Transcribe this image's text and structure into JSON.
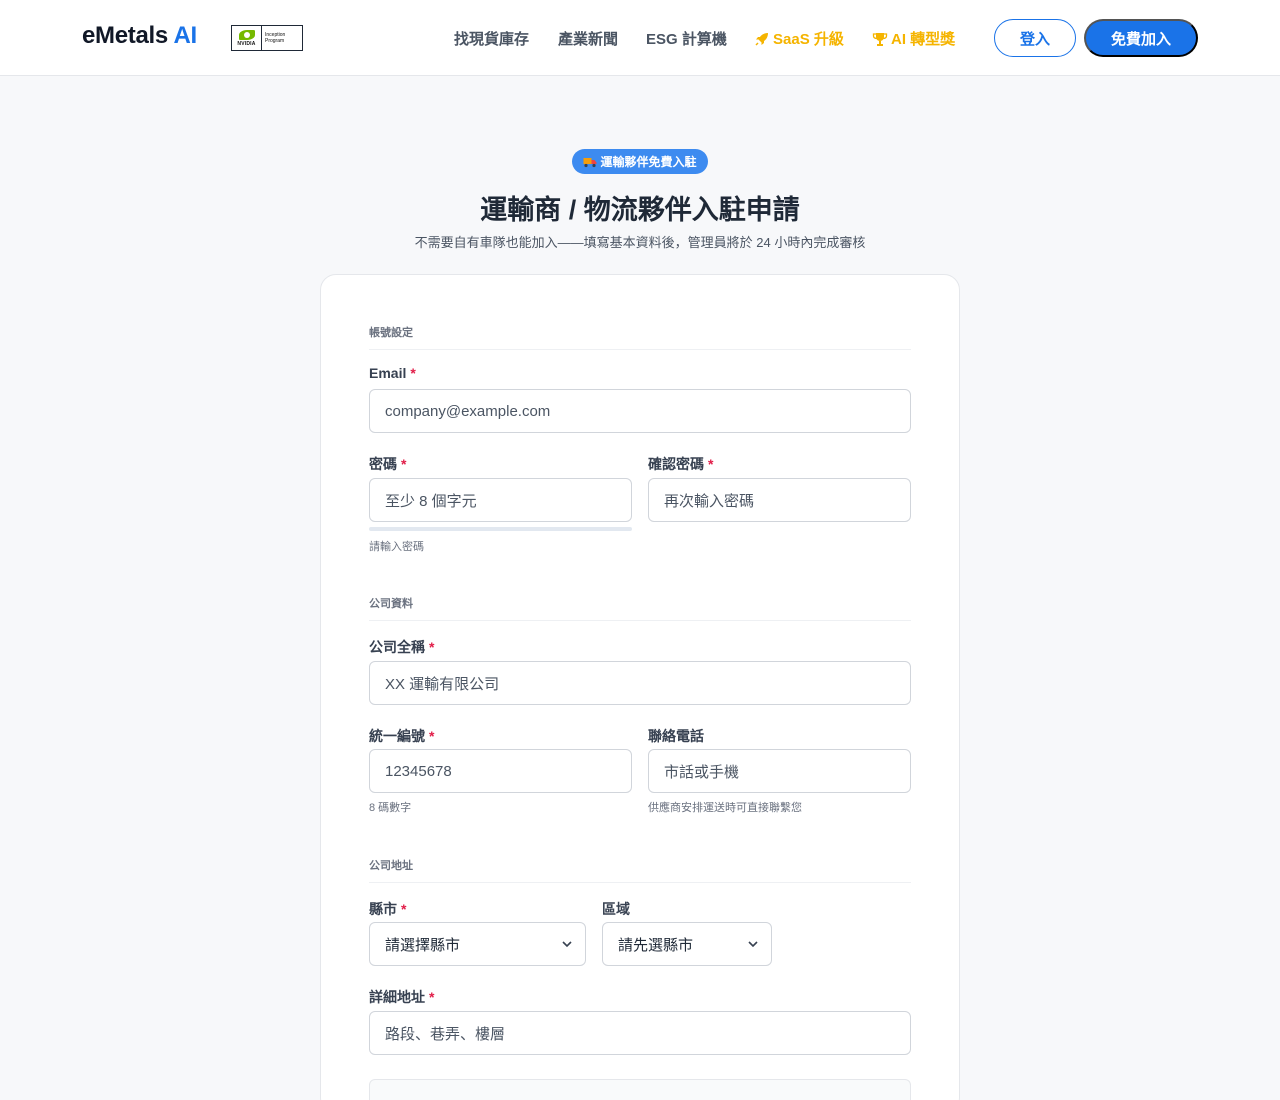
{
  "header": {
    "brand_main": "eMetals",
    "brand_ai": "AI",
    "badge_logo": "NVIDIA",
    "badge_text_1": "Inception",
    "badge_text_2": "Program",
    "nav": [
      {
        "label": "找現貨庫存"
      },
      {
        "label": "產業新聞"
      },
      {
        "label": "ESG 計算機"
      },
      {
        "label": "SaaS 升級",
        "icon": "rocket-icon"
      },
      {
        "label": "AI 轉型獎",
        "icon": "trophy-icon"
      }
    ],
    "login_label": "登入",
    "join_label": "免費加入",
    "accent_color": "#1a73e8",
    "gold_color": "#f5b400"
  },
  "hero": {
    "pill_icon": "truck-icon",
    "pill_label": "運輸夥伴免費入駐",
    "title": "運輸商 / 物流夥伴入駐申請",
    "subtitle": "不需要自有車隊也能加入——填寫基本資料後，管理員將於 24 小時內完成審核"
  },
  "form": {
    "account": {
      "section_title": "帳號設定",
      "email": {
        "label": "Email",
        "placeholder": "company@example.com"
      },
      "password": {
        "label": "密碼",
        "placeholder": "至少 8 個字元",
        "hint": "請輸入密碼"
      },
      "confirm": {
        "label": "確認密碼",
        "placeholder": "再次輸入密碼"
      }
    },
    "company": {
      "section_title": "公司資料",
      "name": {
        "label": "公司全稱",
        "placeholder": "XX 運輸有限公司"
      },
      "tax_id": {
        "label": "統一編號",
        "placeholder": "12345678",
        "hint": "8 碼數字"
      },
      "phone": {
        "label": "聯絡電話",
        "placeholder": "市話或手機",
        "hint": "供應商安排運送時可直接聯繫您"
      }
    },
    "address": {
      "section_title": "公司地址",
      "city": {
        "label": "縣市",
        "selected": "請選擇縣市"
      },
      "district": {
        "label": "區域",
        "selected": "請先選縣市"
      },
      "detail": {
        "label": "詳細地址",
        "placeholder": "路段、巷弄、樓層"
      }
    },
    "required_mark": "*"
  }
}
